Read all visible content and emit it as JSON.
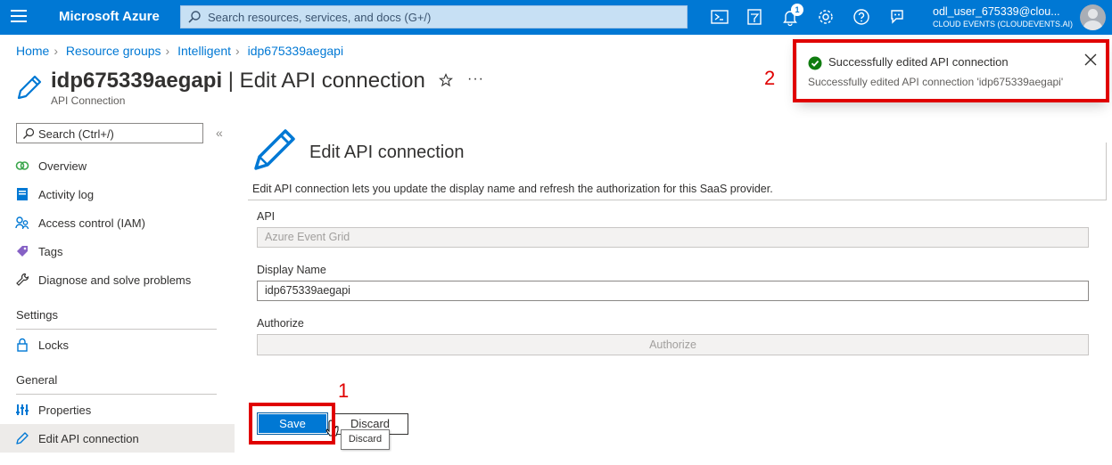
{
  "topbar": {
    "brand": "Microsoft Azure",
    "search_placeholder": "Search resources, services, and docs (G+/)",
    "notification_count": "1",
    "user_name": "odl_user_675339@clou...",
    "user_directory": "CLOUD EVENTS (CLOUDEVENTS.AI)",
    "icons": [
      "cloud-shell-icon",
      "directory-filter-icon",
      "bell-icon",
      "gear-icon",
      "help-icon",
      "feedback-icon"
    ]
  },
  "breadcrumb": [
    "Home",
    "Resource groups",
    "Intelligent",
    "idp675339aegapi"
  ],
  "page": {
    "title_bold": "idp675339aegapi",
    "title_rest": " | Edit API connection",
    "subtitle": "API Connection",
    "more": "···"
  },
  "sidebar": {
    "search_placeholder": "Search (Ctrl+/)",
    "collapse": "«",
    "items": [
      {
        "label": "Overview",
        "icon": "overview-icon"
      },
      {
        "label": "Activity log",
        "icon": "activity-log-icon"
      },
      {
        "label": "Access control (IAM)",
        "icon": "iam-icon"
      },
      {
        "label": "Tags",
        "icon": "tag-icon"
      },
      {
        "label": "Diagnose and solve problems",
        "icon": "wrench-icon"
      }
    ],
    "section_settings": "Settings",
    "settings_items": [
      {
        "label": "Locks",
        "icon": "lock-icon"
      }
    ],
    "section_general": "General",
    "general_items": [
      {
        "label": "Properties",
        "icon": "properties-icon"
      },
      {
        "label": "Edit API connection",
        "icon": "pencil-icon",
        "active": true
      }
    ]
  },
  "content": {
    "title": "Edit API connection",
    "description": "Edit API connection lets you update the display name and refresh the authorization for this SaaS provider.",
    "api_label": "API",
    "api_value": "Azure Event Grid",
    "display_name_label": "Display Name",
    "display_name_value": "idp675339aegapi",
    "authorize_label": "Authorize",
    "authorize_button": "Authorize",
    "save_button": "Save",
    "discard_button": "Discard",
    "tooltip": "Discard"
  },
  "annotations": {
    "marker_1": "1",
    "marker_2": "2"
  },
  "toast": {
    "title": "Successfully edited API connection",
    "message": "Successfully edited API connection 'idp675339aegapi'"
  },
  "colors": {
    "azure_blue": "#0078d4",
    "success_green": "#107c10",
    "highlight_red": "#e00000"
  }
}
